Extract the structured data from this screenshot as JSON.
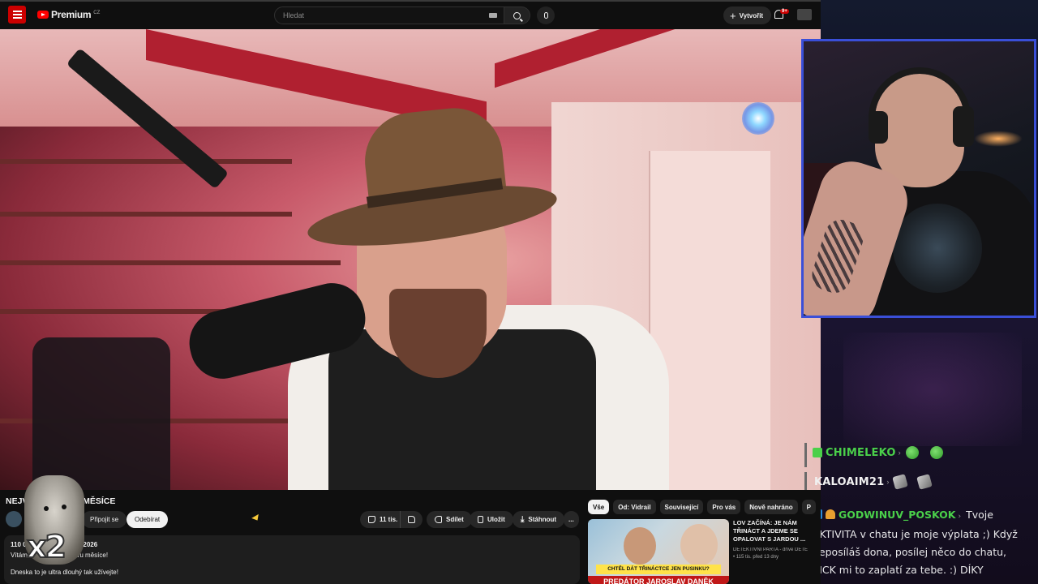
{
  "header": {
    "logo_text": "Premium",
    "logo_country": "CZ",
    "search_placeholder": "Hledat",
    "create_label": "Vytvořit",
    "notif_count": "9+",
    "account_label": "kanál"
  },
  "video": {
    "title": "NEJVĚTŠÍ BIZÁRY MĚSÍCE",
    "join_label": "Připojit se",
    "subscribe_label": "Odebírat",
    "likes": "11 tis.",
    "share_label": "Sdílet",
    "save_label": "Uložit",
    "download_label": "Stáhnout",
    "more_label": "...",
    "description_date": "110 0… zhlédnutí 13. 8. 2026",
    "description_line1": "Vítám … u dalšího bizáru měsíce!",
    "description_line2": "Dneska to je ultra dlouhý tak užívejte!"
  },
  "meme_overlay": {
    "label": "x2"
  },
  "chips": [
    "Vše",
    "Od: Vidrail",
    "Související",
    "Pro vás",
    "Nově nahráno",
    "P"
  ],
  "recommendation": {
    "title": "LOV ZAČÍNÁ: JE NÁM TŘINÁCT A JDEME SE OPALOVAT S JARDOU ...",
    "channel": "DETEKTIVNÍ PARTA - dříve DETE",
    "stats": "115 tis. před 13 dny",
    "thumb_caption_top": "CHTĚL DÁT TŘINÁCTCE JEN PUSINKU?",
    "thumb_caption_bottom": "PREDÁTOR JAROSLAV DANĚK"
  },
  "chat": {
    "messages": [
      {
        "user": "CHIMELEKO",
        "color": "#4ad04a",
        "emotes": [
          "frog",
          "frog"
        ]
      },
      {
        "user": "KALOAIM21",
        "color": "#f1f1f1",
        "emotes": [
          "sock",
          "sock"
        ]
      }
    ],
    "long_message": {
      "user": "GODWINUV_POSKOK",
      "text": "Tvoje AKTIVITA v chatu je moje výplata ;) Když neposíláš dona, posílej něco do chatu, KICK mi to zaplatí za tebe. :) DÍKY"
    }
  },
  "colors": {
    "youtube_red": "#ff0000",
    "cam_border": "#3a4fd8",
    "chat_green": "#4ad04a"
  }
}
